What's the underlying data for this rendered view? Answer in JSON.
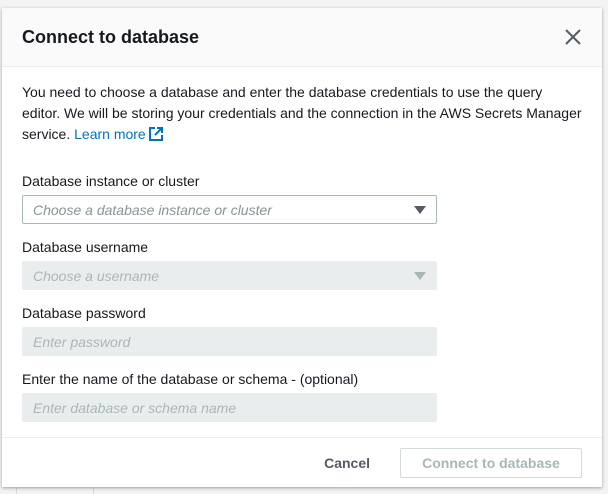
{
  "dialog": {
    "title": "Connect to database",
    "description": "You need to choose a database and enter the database credentials to use the query editor. We will be storing your credentials and the connection in the AWS Secrets Manager service.",
    "learn_more": "Learn more"
  },
  "fields": [
    {
      "label": "Database instance or cluster",
      "placeholder": "Choose a database instance or cluster"
    },
    {
      "label": "Database username",
      "placeholder": "Choose a username"
    },
    {
      "label": "Database password",
      "placeholder": "Enter password"
    },
    {
      "label": "Enter the name of the database or schema - (optional)",
      "placeholder": "Enter database or schema name"
    }
  ],
  "footer": {
    "cancel": "Cancel",
    "connect": "Connect to database"
  },
  "colors": {
    "link": "#0073bb",
    "disabled": "#aab7b8"
  }
}
